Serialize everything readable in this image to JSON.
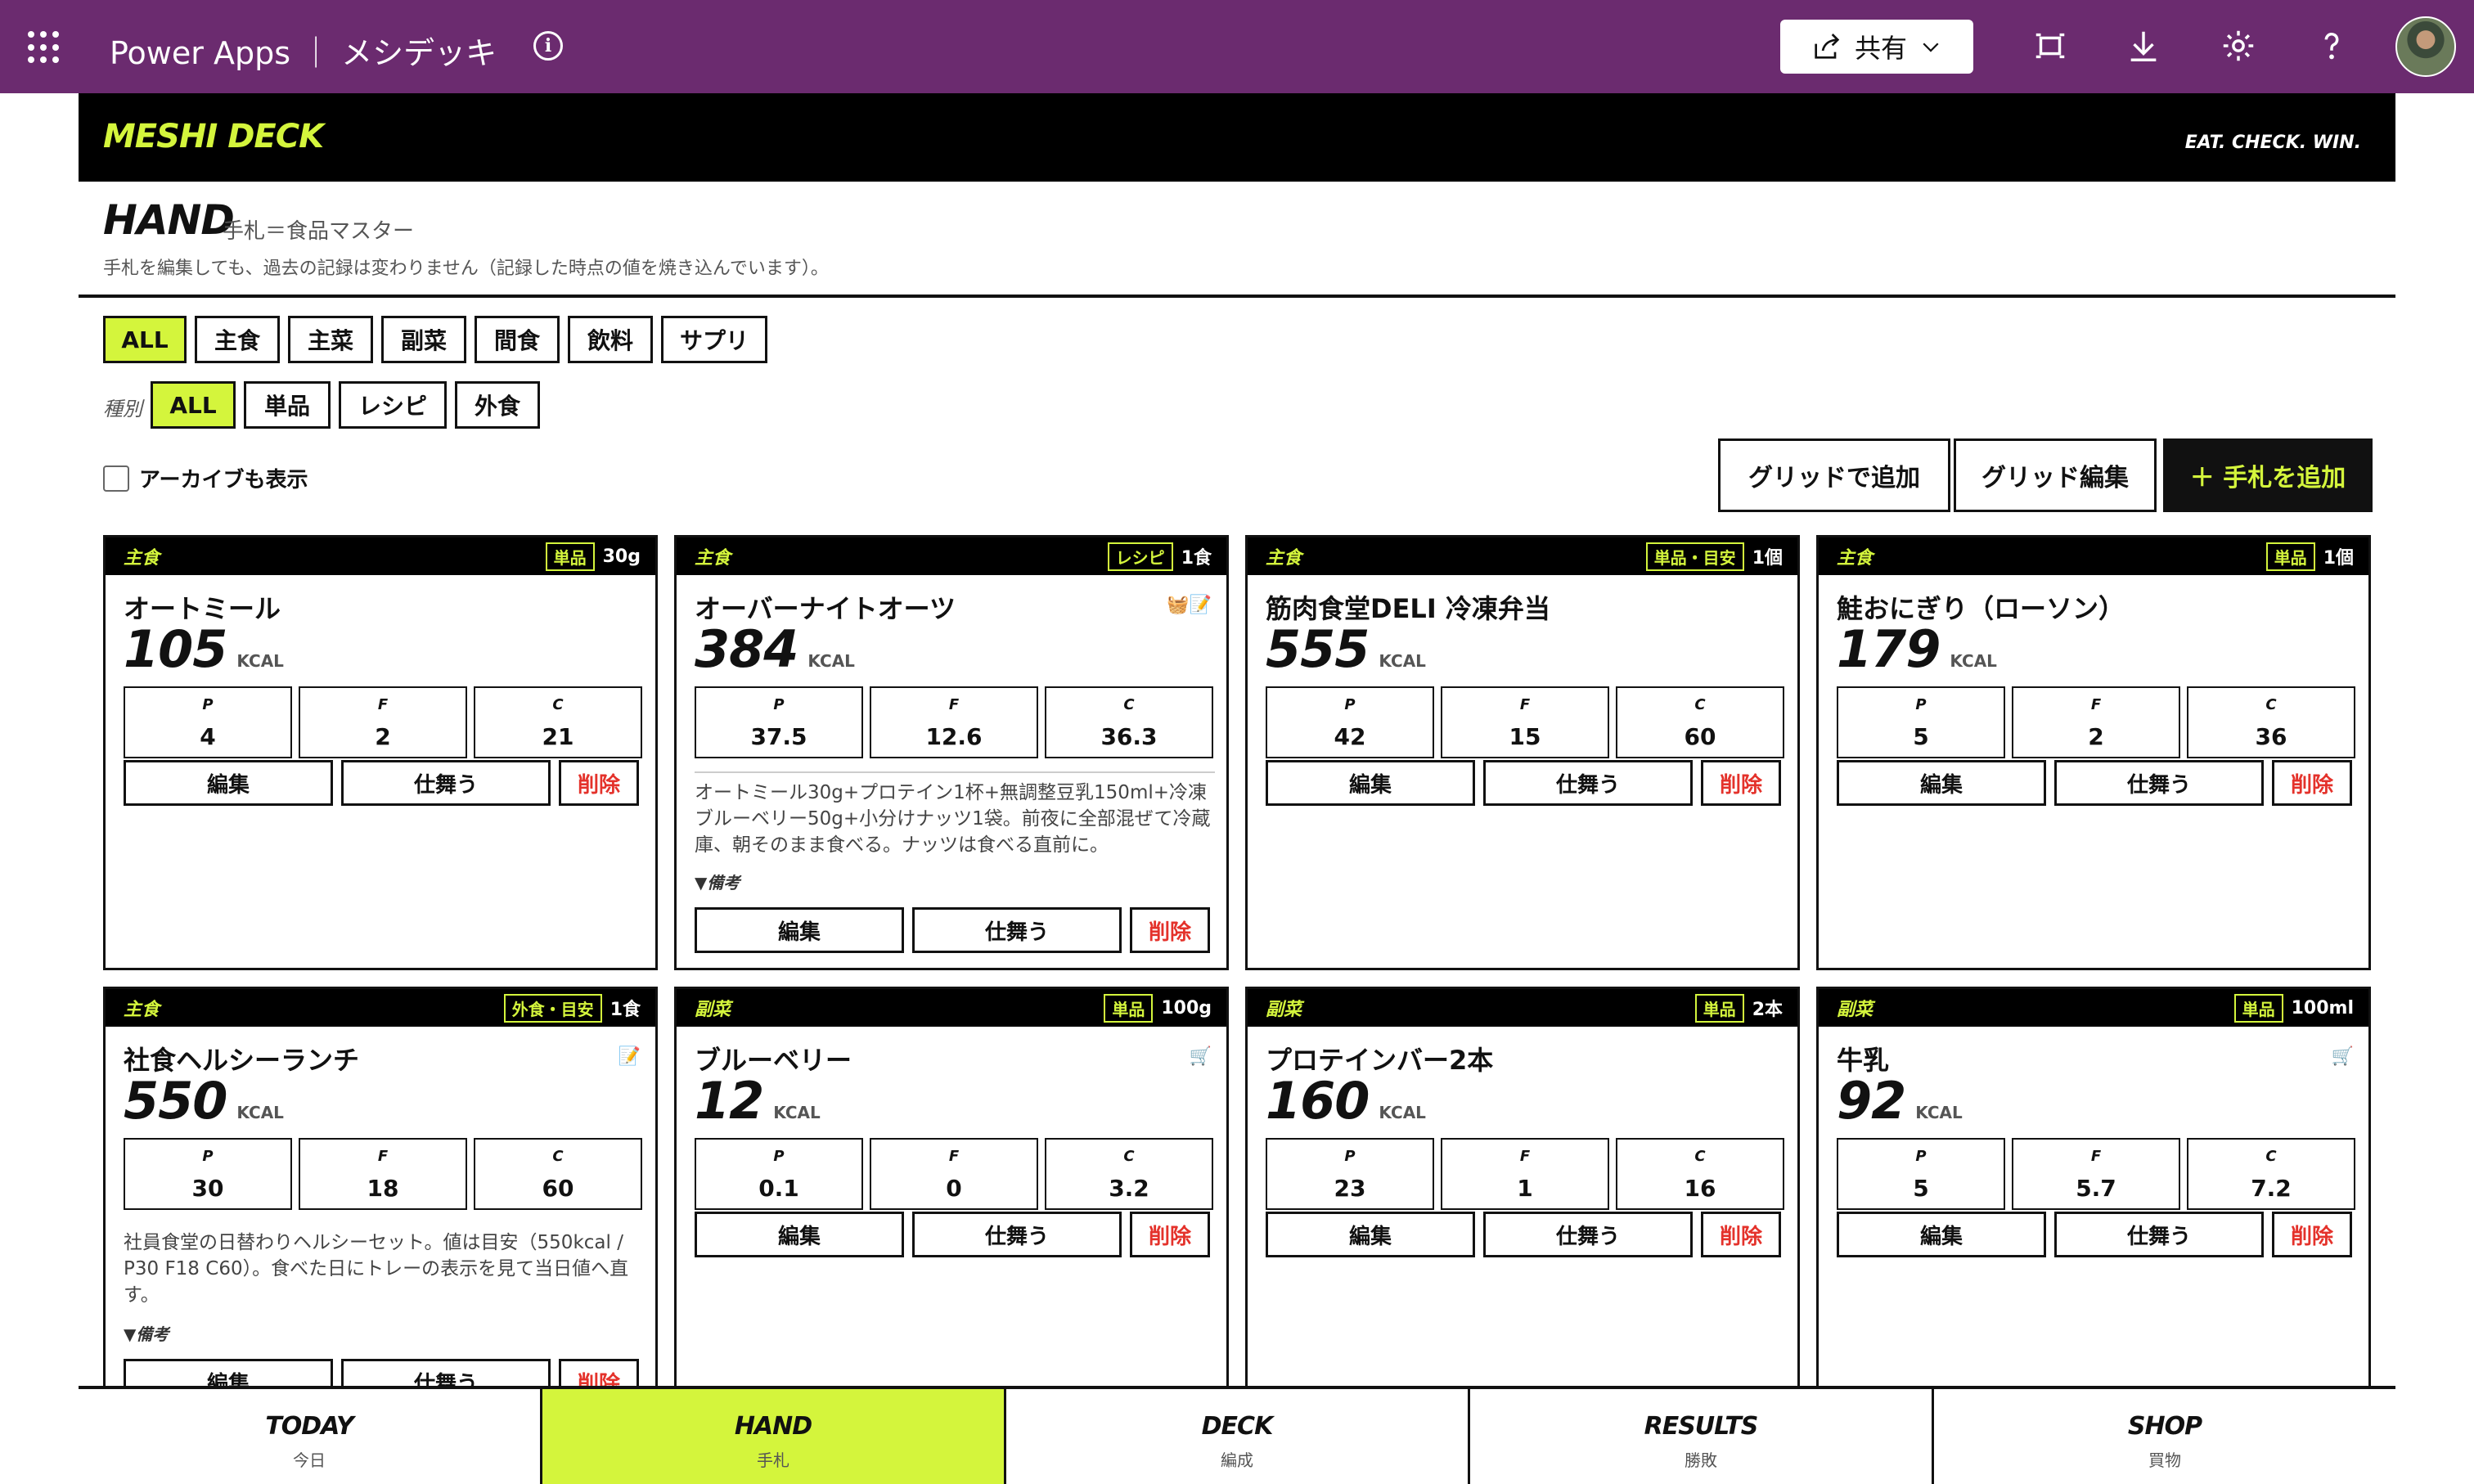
{
  "power_apps": {
    "title": "Power Apps ｜ メシデッキ",
    "share_label": "共有",
    "icons": [
      "waffle-icon",
      "info-icon",
      "share-icon",
      "chevron-down-icon",
      "fullscreen-icon",
      "download-icon",
      "gear-icon",
      "help-icon",
      "avatar"
    ]
  },
  "header": {
    "logo": "MESHI DECK",
    "tagline": "EAT. CHECK. WIN."
  },
  "hand": {
    "title": "HAND",
    "subtitle": "手札＝食品マスター",
    "note": "手札を編集しても、過去の記録は変わりません（記録した時点の値を焼き込んでいます）。"
  },
  "category_filters": [
    "ALL",
    "主食",
    "主菜",
    "副菜",
    "間食",
    "飲料",
    "サプリ"
  ],
  "kind_filter_label": "種別",
  "kind_filters": [
    "ALL",
    "単品",
    "レシピ",
    "外食"
  ],
  "archive_label": "アーカイブも表示",
  "actions": {
    "grid_add": "グリッドで追加",
    "grid_edit": "グリッド編集",
    "add_card": "＋ 手札を追加"
  },
  "labels": {
    "kcal": "KCAL",
    "p": "P",
    "f": "F",
    "c": "C",
    "edit": "編集",
    "mimic": "仕舞う",
    "delete": "削除",
    "memo": "▼備考"
  },
  "cards": [
    {
      "category": "主食",
      "type": "単品",
      "unit": "30g",
      "name": "オートミール",
      "kcal": "105",
      "p": "4",
      "f": "2",
      "c": "21",
      "icon": "",
      "desc": "",
      "memo": ""
    },
    {
      "category": "主食",
      "type": "レシピ",
      "unit": "1食",
      "name": "オーバーナイトオーツ",
      "kcal": "384",
      "p": "37.5",
      "f": "12.6",
      "c": "36.3",
      "icon": "🧺📝",
      "desc": "オートミール30g+プロテイン1杯+無調整豆乳150ml+冷凍ブルーベリー50g+小分けナッツ1袋。前夜に全部混ぜて冷蔵庫、朝そのまま食べる。ナッツは食べる直前に。",
      "memo": "▼備考"
    },
    {
      "category": "主食",
      "type": "単品・目安",
      "unit": "1個",
      "name": "筋肉食堂DELI 冷凍弁当",
      "kcal": "555",
      "p": "42",
      "f": "15",
      "c": "60",
      "icon": "",
      "desc": "",
      "memo": ""
    },
    {
      "category": "主食",
      "type": "単品",
      "unit": "1個",
      "name": "鮭おにぎり（ローソン）",
      "kcal": "179",
      "p": "5",
      "f": "2",
      "c": "36",
      "icon": "",
      "desc": "",
      "memo": ""
    },
    {
      "category": "主食",
      "type": "外食・目安",
      "unit": "1食",
      "name": "社食ヘルシーランチ",
      "kcal": "550",
      "p": "30",
      "f": "18",
      "c": "60",
      "icon": "📝",
      "desc": "社員食堂の日替わりヘルシーセット。値は目安（550kcal / P30 F18 C60）。食べた日にトレーの表示を見て当日値へ直す。",
      "memo": "▼備考"
    },
    {
      "category": "副菜",
      "type": "単品",
      "unit": "100g",
      "name": "ブルーベリー",
      "kcal": "12",
      "p": "0.1",
      "f": "0",
      "c": "3.2",
      "icon": "🛒",
      "desc": "",
      "memo": ""
    },
    {
      "category": "副菜",
      "type": "単品",
      "unit": "2本",
      "name": "プロテインバー2本",
      "kcal": "160",
      "p": "23",
      "f": "1",
      "c": "16",
      "icon": "",
      "desc": "",
      "memo": ""
    },
    {
      "category": "副菜",
      "type": "単品",
      "unit": "100ml",
      "name": "牛乳",
      "kcal": "92",
      "p": "5",
      "f": "5.7",
      "c": "7.2",
      "icon": "🛒",
      "desc": "",
      "memo": ""
    }
  ],
  "bottom_nav": [
    {
      "en": "TODAY",
      "ja": "今日"
    },
    {
      "en": "HAND",
      "ja": "手札"
    },
    {
      "en": "DECK",
      "ja": "編成"
    },
    {
      "en": "RESULTS",
      "ja": "勝敗"
    },
    {
      "en": "SHOP",
      "ja": "買物"
    }
  ],
  "colors": {
    "power_apps_bar": "#6b2b6f",
    "accent": "#d4f53c",
    "delete": "#e4322b"
  }
}
